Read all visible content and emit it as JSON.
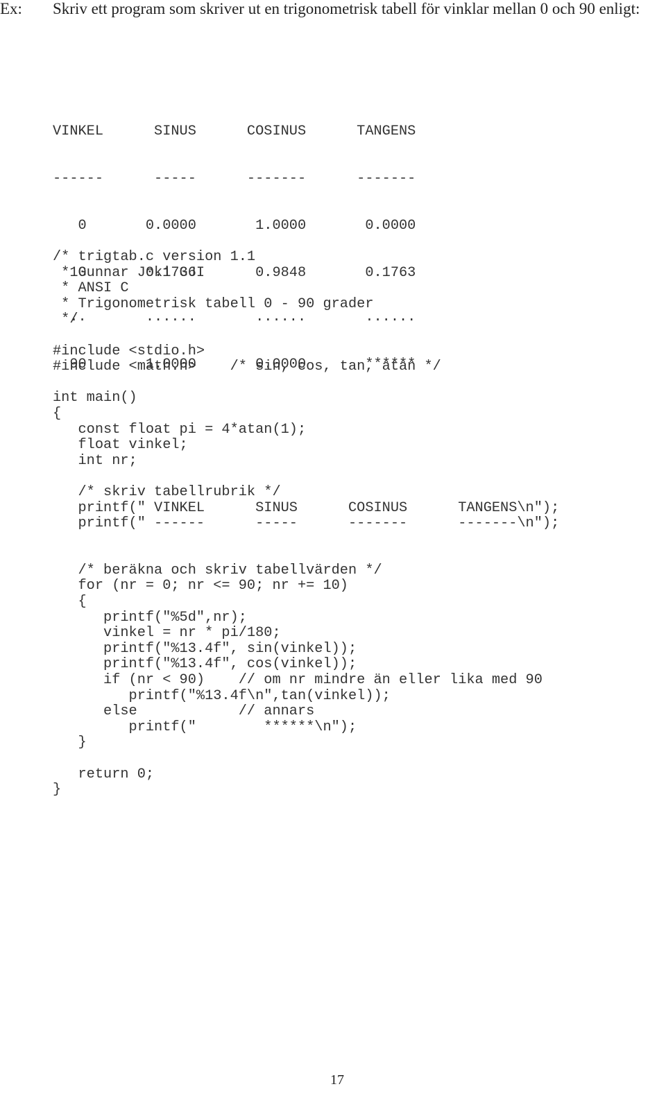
{
  "intro": {
    "label": "Ex:",
    "text": "Skriv ett program som skriver ut en trigonometrisk tabell för vinklar mellan 0 och 90 enligt:"
  },
  "output_table": {
    "headers": [
      "VINKEL",
      "SINUS",
      "COSINUS",
      "TANGENS"
    ],
    "rows": [
      "VINKEL      SINUS      COSINUS      TANGENS",
      "------      -----      -------      -------",
      "   0       0.0000       1.0000       0.0000",
      "  10       0.1736       0.9848       0.1763",
      "  ..       ......       ......       ......",
      "  90       1.0000       0.0000       ******"
    ],
    "data": [
      {
        "vinkel": "0",
        "sinus": "0.0000",
        "cosinus": "1.0000",
        "tangens": "0.0000"
      },
      {
        "vinkel": "10",
        "sinus": "0.1736",
        "cosinus": "0.9848",
        "tangens": "0.1763"
      },
      {
        "vinkel": "..",
        "sinus": "......",
        "cosinus": "......",
        "tangens": "......"
      },
      {
        "vinkel": "90",
        "sinus": "1.0000",
        "cosinus": "0.0000",
        "tangens": "******"
      }
    ]
  },
  "code": {
    "lines": [
      "/* trigtab.c version 1.1",
      " * Gunnar Joki GJI",
      " * ANSI C",
      " * Trigonometrisk tabell 0 - 90 grader",
      " */",
      "",
      "#include <stdio.h>",
      "#include <math.h>    /* sin, cos, tan, atan */",
      "",
      "int main()",
      "{",
      "   const float pi = 4*atan(1);",
      "   float vinkel;",
      "   int nr;",
      "",
      "   /* skriv tabellrubrik */",
      "   printf(\" VINKEL      SINUS      COSINUS      TANGENS\\n\");",
      "   printf(\" ------      -----      -------      -------\\n\");",
      "",
      "",
      "   /* beräkna och skriv tabellvärden */",
      "   for (nr = 0; nr <= 90; nr += 10)",
      "   {",
      "      printf(\"%5d\",nr);",
      "      vinkel = nr * pi/180;",
      "      printf(\"%13.4f\", sin(vinkel));",
      "      printf(\"%13.4f\", cos(vinkel));",
      "      if (nr < 90)    // om nr mindre än eller lika med 90",
      "         printf(\"%13.4f\\n\",tan(vinkel));",
      "      else            // annars",
      "         printf(\"        ******\\n\");",
      "   }",
      "",
      "   return 0;",
      "}"
    ]
  },
  "footer": {
    "page_number": "17"
  }
}
